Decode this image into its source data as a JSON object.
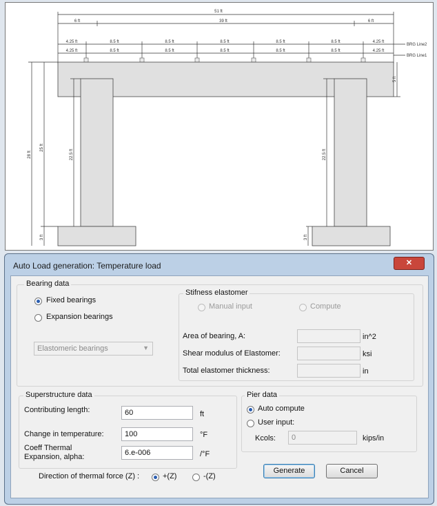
{
  "drawing": {
    "top_dims": {
      "overall": "51 ft",
      "middle": "39 ft",
      "side_left": "6 ft",
      "side_right": "6 ft"
    },
    "spacing_labels": [
      "4.25 ft",
      "8.5 ft",
      "8.5 ft",
      "8.5 ft",
      "8.5 ft",
      "8.5 ft",
      "4.25 ft"
    ],
    "bearing_lines": {
      "line2": "BRG Line2",
      "line1": "BRG Line1"
    },
    "left_dims": {
      "total": "28 ft",
      "column": "25 ft",
      "col_clear": "22.5 ft",
      "footing": "3 ft"
    },
    "right_dims": {
      "cap": "5 ft",
      "col_clear": "22.5 ft",
      "footing": "3 ft"
    }
  },
  "dialog": {
    "title": "Auto Load generation: Temperature load",
    "close_label": "✕",
    "bearing": {
      "legend": "Bearing data",
      "fixed_label": "Fixed bearings",
      "expansion_label": "Expansion bearings",
      "selected": "fixed",
      "type_value": "Elastomeric bearings"
    },
    "stiffness": {
      "legend": "Stifness elastomer",
      "manual_label": "Manual input",
      "compute_label": "Compute",
      "area_label": "Area of bearing, A:",
      "area_unit": "in^2",
      "shear_label": "Shear modulus of Elastomer:",
      "shear_unit": "ksi",
      "thickness_label": "Total elastomer thickness:",
      "thickness_unit": "in"
    },
    "superstructure": {
      "legend": "Superstructure data",
      "length_label": "Contributing length:",
      "length_value": "60",
      "length_unit": "ft",
      "temp_label": "Change in temperature:",
      "temp_value": "100",
      "temp_unit": "°F",
      "coeff_label_1": "Coeff Thermal",
      "coeff_label_2": "Expansion, alpha:",
      "coeff_value": "6.e-006",
      "coeff_unit": "/°F"
    },
    "pier": {
      "legend": "Pier data",
      "auto_label": "Auto compute",
      "user_label": "User input:",
      "selected": "auto",
      "kcols_label": "Kcols:",
      "kcols_value": "0",
      "kcols_unit": "kips/in"
    },
    "direction": {
      "label": "Direction of thermal force (Z) :",
      "plus_label": "+(Z)",
      "minus_label": "-(Z)",
      "selected": "+Z"
    },
    "generate_label": "Generate",
    "cancel_label": "Cancel"
  }
}
